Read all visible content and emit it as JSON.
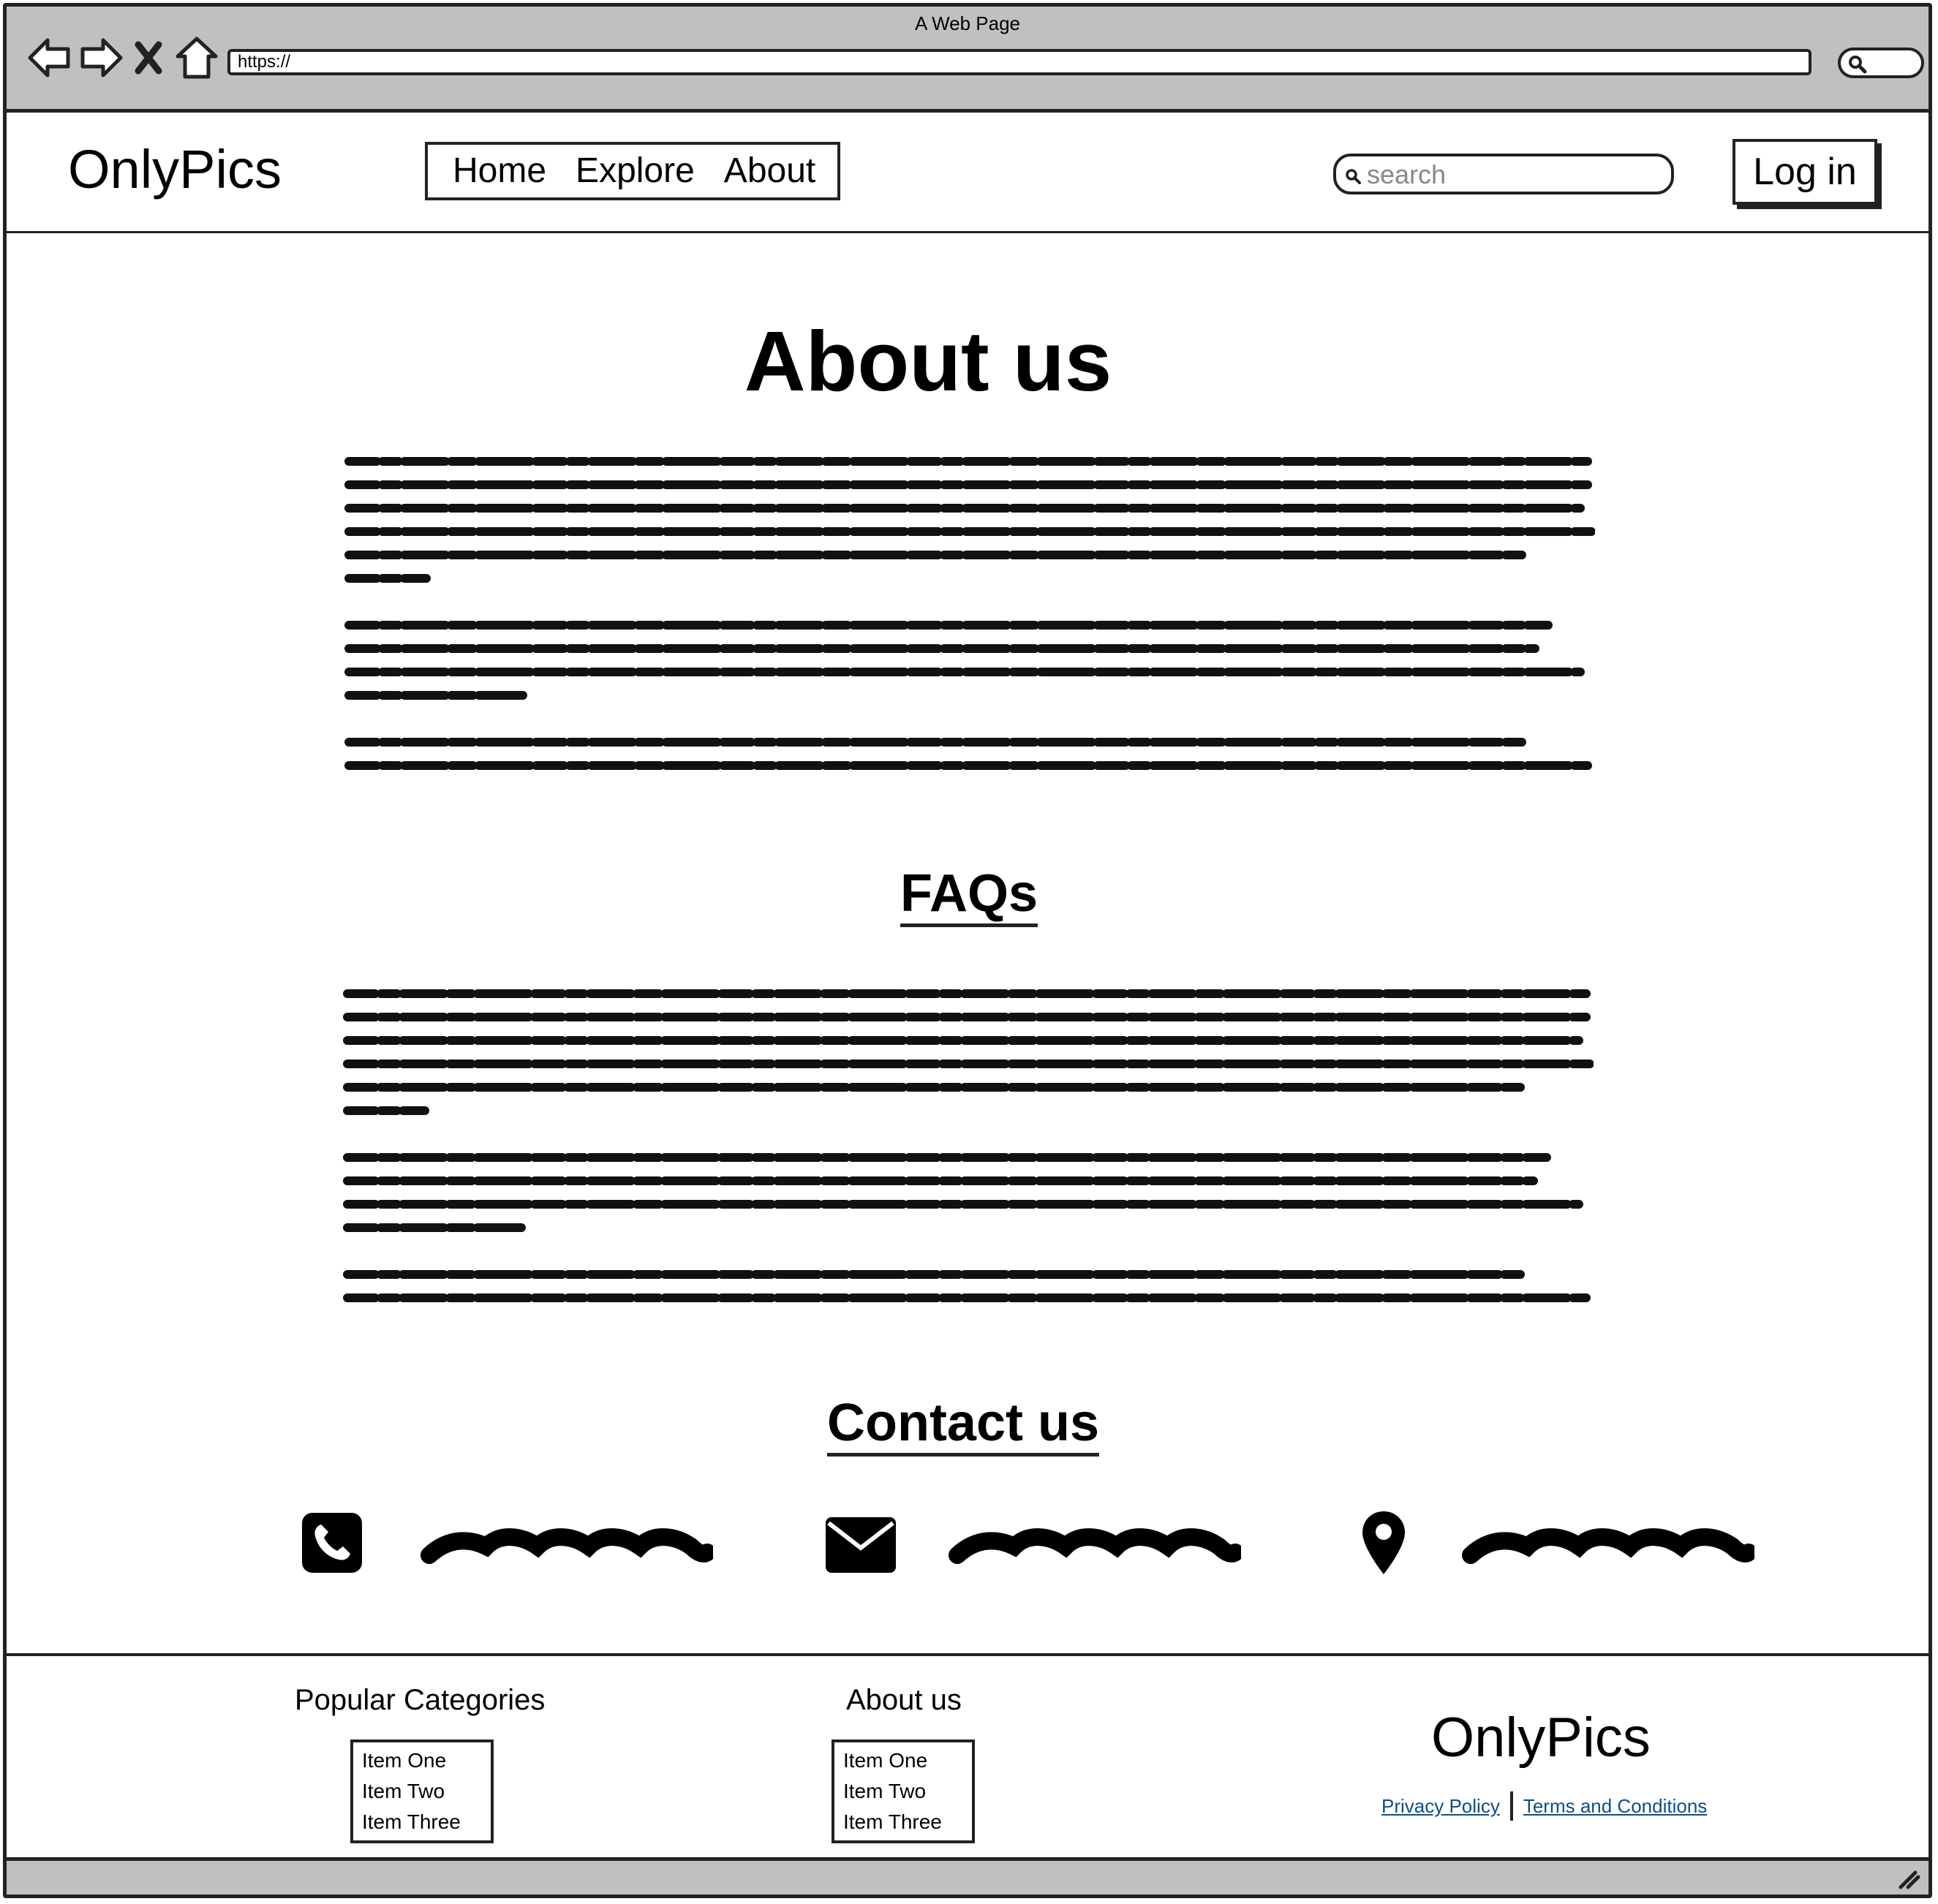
{
  "browser": {
    "window_title": "A Web Page",
    "url": "https://"
  },
  "header": {
    "logo": "OnlyPics",
    "nav": [
      "Home",
      "Explore",
      "About"
    ],
    "search_placeholder": "search",
    "login_label": "Log in"
  },
  "main": {
    "title": "About us",
    "faq_title": "FAQs",
    "contact_title": "Contact us",
    "contact_items": [
      {
        "icon": "phone-icon"
      },
      {
        "icon": "envelope-icon"
      },
      {
        "icon": "map-pin-icon"
      }
    ]
  },
  "footer": {
    "col1_title": "Popular Categories",
    "col1_items": [
      "Item One",
      "Item Two",
      "Item Three"
    ],
    "col2_title": "About us",
    "col2_items": [
      "Item One",
      "Item Two",
      "Item Three"
    ],
    "logo": "OnlyPics",
    "privacy_label": "Privacy Policy",
    "terms_label": "Terms and Conditions"
  }
}
